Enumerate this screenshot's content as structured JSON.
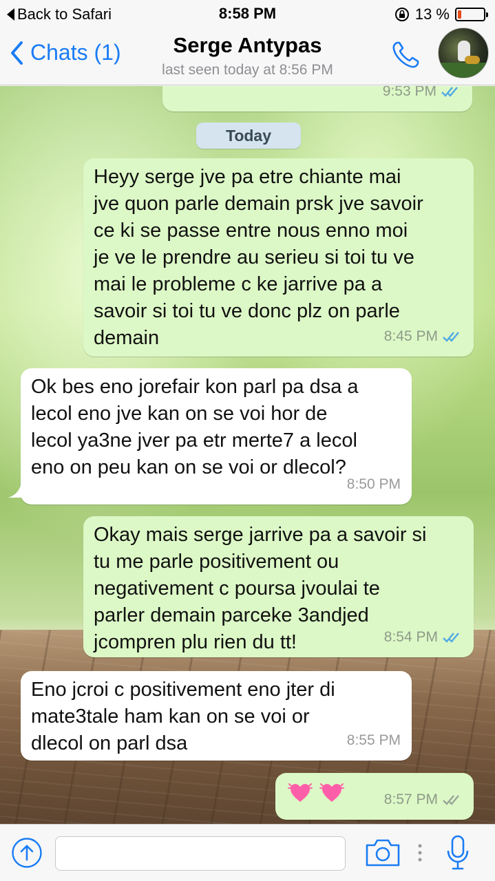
{
  "status_bar": {
    "back_label": "Back to Safari",
    "time": "8:58 PM",
    "battery_text": "13 %",
    "battery_level": 0.13,
    "icons": [
      "back-triangle-icon",
      "rotation-lock-icon",
      "battery-icon"
    ]
  },
  "nav": {
    "back_label": "Chats (1)",
    "title": "Serge Antypas",
    "subtitle": "last seen today at 8:56 PM",
    "icons": [
      "chevron-left-icon",
      "phone-icon",
      "avatar"
    ]
  },
  "chat": {
    "top_message_time": "9:53 PM",
    "date_separator": "Today",
    "messages": [
      {
        "direction": "out",
        "lines": [
          "Heyy serge jve pa etre chiante mai",
          "jve quon parle demain prsk jve savoir",
          "ce ki se passe entre nous enno moi",
          "je ve le prendre au serieu si toi tu ve",
          "mai le probleme c ke jarrive pa a",
          "savoir si toi tu ve donc plz on parle",
          "demain"
        ],
        "time": "8:45 PM",
        "status": "read"
      },
      {
        "direction": "in",
        "lines": [
          "Ok bes eno jorefair kon parl pa dsa a",
          "lecol eno jve kan on se voi hor de",
          "lecol ya3ne jver pa etr merte7 a lecol",
          "eno on peu kan on se voi or dlecol?"
        ],
        "time": "8:50 PM"
      },
      {
        "direction": "out",
        "lines": [
          "Okay mais serge jarrive pa a savoir si",
          "tu me parle positivement ou",
          "negativement c poursa jvoulai te",
          "parler demain parceke 3andjed",
          "jcompren plu rien du tt!"
        ],
        "time": "8:54 PM",
        "status": "read"
      },
      {
        "direction": "in",
        "lines": [
          "Eno jcroi c positivement eno jter di",
          "mate3tale ham kan on se voi or",
          "dlecol on parl dsa"
        ],
        "time": "8:55 PM"
      },
      {
        "direction": "out",
        "emoji": [
          "sparkling-heart-icon",
          "sparkling-heart-icon"
        ],
        "time": "8:57 PM",
        "status": "delivered"
      }
    ]
  },
  "input_bar": {
    "placeholder": "",
    "icons": [
      "attach-arrow-icon",
      "camera-icon",
      "mic-icon"
    ]
  },
  "colors": {
    "accent": "#1a7cf5",
    "outgoing_bubble": "#dcf8c6",
    "incoming_bubble": "#ffffff",
    "read_ticks": "#4fa9e6",
    "delivered_ticks": "#9aa59a",
    "battery_low": "#e64a19"
  }
}
